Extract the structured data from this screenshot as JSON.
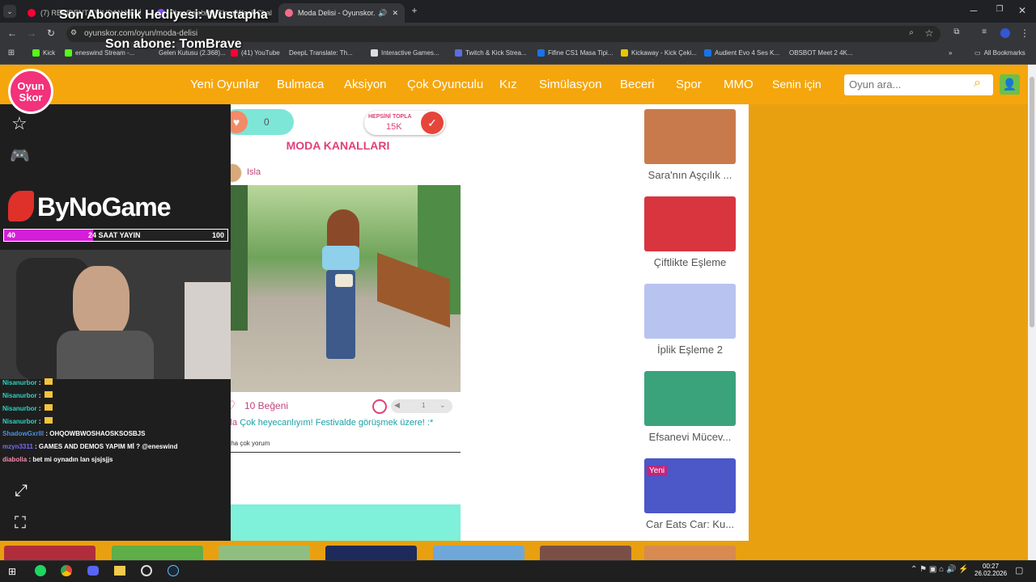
{
  "browser": {
    "tabs": [
      {
        "title": "(7) RESIDENT EVIL'DAN YENİ"
      },
      {
        "title": "Play Celebrity Glam Week Chal"
      },
      {
        "title": "Moda Delisi - Oyunskor.com"
      }
    ],
    "url": "oyunskor.com/oyun/moda-delisi",
    "bookmarks": [
      "Kick",
      "eneswind Stream -...",
      "Gelen Kutusu (2.368)...",
      "(41) YouTube",
      "DeepL Translate: Th...",
      "Interactive Games...",
      "Twitch & Kick Strea...",
      "Fifine CS1 Masa Tipi...",
      "Kickaway - Kick Çeki...",
      "Audient Evo 4 Ses K...",
      "OBSBOT Meet 2 4K..."
    ],
    "all_bookmarks": "All Bookmarks"
  },
  "site": {
    "logo_line1": "Oyun",
    "logo_line2": "Skor",
    "nav": [
      "Yeni Oyunlar",
      "Bulmaca",
      "Aksiyon",
      "Çok Oyunculu",
      "Kız",
      "Simülasyon",
      "Beceri",
      "Spor",
      "MMO",
      "Senin için"
    ],
    "search_placeholder": "Oyun ara..."
  },
  "game": {
    "heart_count": "0",
    "collect_label": "HEPSİNİ TOPLA",
    "collect_value": "15K",
    "channel_title": "MODA KANALLARI",
    "author": "Isla",
    "likes_text": "10 Beğeni",
    "stepper_value": "1",
    "caption": "Çok heyecanlıyım! Festivalde görüşmek üzere! :*",
    "more_comments": "Daha çok yorum"
  },
  "related": [
    {
      "title": "Sara'nın Aşçılık ..."
    },
    {
      "title": "Çiftlikte Eşleme"
    },
    {
      "title": "İplik Eşleme 2"
    },
    {
      "title": "Efsanevi Mücev..."
    },
    {
      "title": "Car Eats Car: Ku...",
      "badge": "Yeni"
    }
  ],
  "overlay": {
    "gift_alert": "Son Abonelik Hediyesi: Wustapha",
    "last_sub": "Son abone: TomBrave",
    "brand": "ByNoGame",
    "progress": {
      "start": "40",
      "label": "24 SAAT YAYIN",
      "end": "100",
      "fill_fraction": 0.4
    },
    "chat": [
      {
        "user": "Nisanurbor",
        "text": ""
      },
      {
        "user": "Nisanurbor",
        "text": ""
      },
      {
        "user": "Nisanurbor",
        "text": ""
      },
      {
        "user": "Nisanurbor",
        "text": ""
      },
      {
        "user": "ShadowGxrlll",
        "text": "OHQOWBWOSHAOSKSOSBJS"
      },
      {
        "user": "mzyn3311",
        "text": "GAMES AND DEMOS YAPIM Mİ ? @eneswind"
      },
      {
        "user": "diabolia",
        "text": "bet mi oynadın lan sjsjsjjs"
      }
    ]
  },
  "taskbar": {
    "time": "00:27",
    "date": "26.02.2026"
  }
}
